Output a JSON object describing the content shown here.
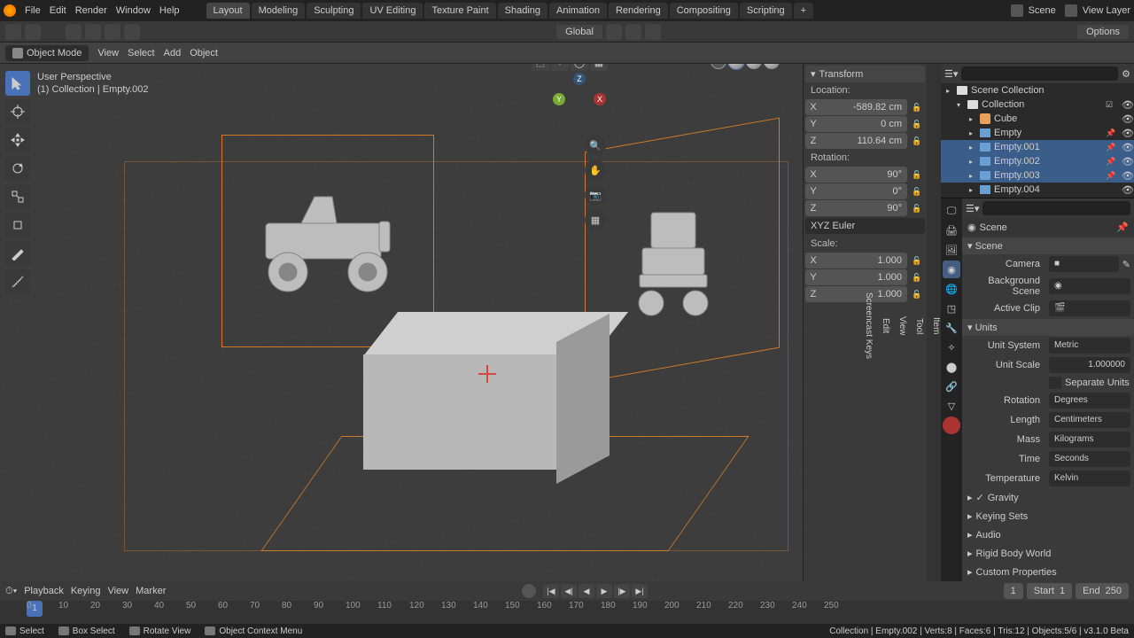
{
  "topmenu": {
    "file": "File",
    "edit": "Edit",
    "render": "Render",
    "window": "Window",
    "help": "Help"
  },
  "workspaces": [
    "Layout",
    "Modeling",
    "Sculpting",
    "UV Editing",
    "Texture Paint",
    "Shading",
    "Animation",
    "Rendering",
    "Compositing",
    "Scripting"
  ],
  "active_workspace": 0,
  "scene_name": "Scene",
  "viewlayer_name": "View Layer",
  "toolheader": {
    "orientation": "Global",
    "options": "Options"
  },
  "mode": {
    "label": "Object Mode",
    "view": "View",
    "select": "Select",
    "add": "Add",
    "object": "Object"
  },
  "viewport_overlay": {
    "line1": "User Perspective",
    "line2": "(1) Collection | Empty.002"
  },
  "nav_axes": {
    "x": "X",
    "y": "Y",
    "z": "Z"
  },
  "transform": {
    "header": "Transform",
    "loc_label": "Location:",
    "loc": {
      "x": "-589.82 cm",
      "y": "0 cm",
      "z": "110.64 cm"
    },
    "rot_label": "Rotation:",
    "rot": {
      "x": "90°",
      "y": "0°",
      "z": "90°"
    },
    "rot_mode": "XYZ Euler",
    "scale_label": "Scale:",
    "scale": {
      "x": "1.000",
      "y": "1.000",
      "z": "1.000"
    }
  },
  "npanel_tabs": [
    "Item",
    "Tool",
    "View",
    "Edit",
    "Screencast Keys"
  ],
  "outliner": {
    "root": "Scene Collection",
    "coll": "Collection",
    "items": [
      {
        "name": "Cube",
        "type": "mesh",
        "sel": false
      },
      {
        "name": "Empty",
        "type": "img",
        "sel": false
      },
      {
        "name": "Empty.001",
        "type": "img",
        "sel": true
      },
      {
        "name": "Empty.002",
        "type": "img",
        "sel": true
      },
      {
        "name": "Empty.003",
        "type": "img",
        "sel": true
      },
      {
        "name": "Empty.004",
        "type": "img",
        "sel": false
      }
    ]
  },
  "properties": {
    "breadcrumb": "Scene",
    "scene_panel": "Scene",
    "camera": {
      "label": "Camera",
      "value": ""
    },
    "bgscene": {
      "label": "Background Scene",
      "value": ""
    },
    "activeclip": {
      "label": "Active Clip",
      "value": ""
    },
    "units": {
      "header": "Units",
      "unit_system_label": "Unit System",
      "unit_system": "Metric",
      "unit_scale_label": "Unit Scale",
      "unit_scale": "1.000000",
      "separate": "Separate Units",
      "rotation_label": "Rotation",
      "rotation": "Degrees",
      "length_label": "Length",
      "length": "Centimeters",
      "mass_label": "Mass",
      "mass": "Kilograms",
      "time_label": "Time",
      "time": "Seconds",
      "temperature_label": "Temperature",
      "temperature": "Kelvin"
    },
    "gravity": "Gravity",
    "keying": "Keying Sets",
    "audio": "Audio",
    "rigid": "Rigid Body World",
    "custom": "Custom Properties"
  },
  "timeline": {
    "playback": "Playback",
    "keying": "Keying",
    "view": "View",
    "marker": "Marker",
    "current": "1",
    "start_label": "Start",
    "start": "1",
    "end_label": "End",
    "end": "250",
    "ticks": [
      0,
      10,
      20,
      30,
      40,
      50,
      60,
      70,
      80,
      90,
      100,
      110,
      120,
      130,
      140,
      150,
      160,
      170,
      180,
      190,
      200,
      210,
      220,
      230,
      240,
      250
    ]
  },
  "statusbar": {
    "select": "Select",
    "box": "Box Select",
    "rotate": "Rotate View",
    "context": "Object Context Menu",
    "info": "Collection | Empty.002 | Verts:8 | Faces:6 | Tris:12 | Objects:5/6 | v3.1.0 Beta"
  }
}
